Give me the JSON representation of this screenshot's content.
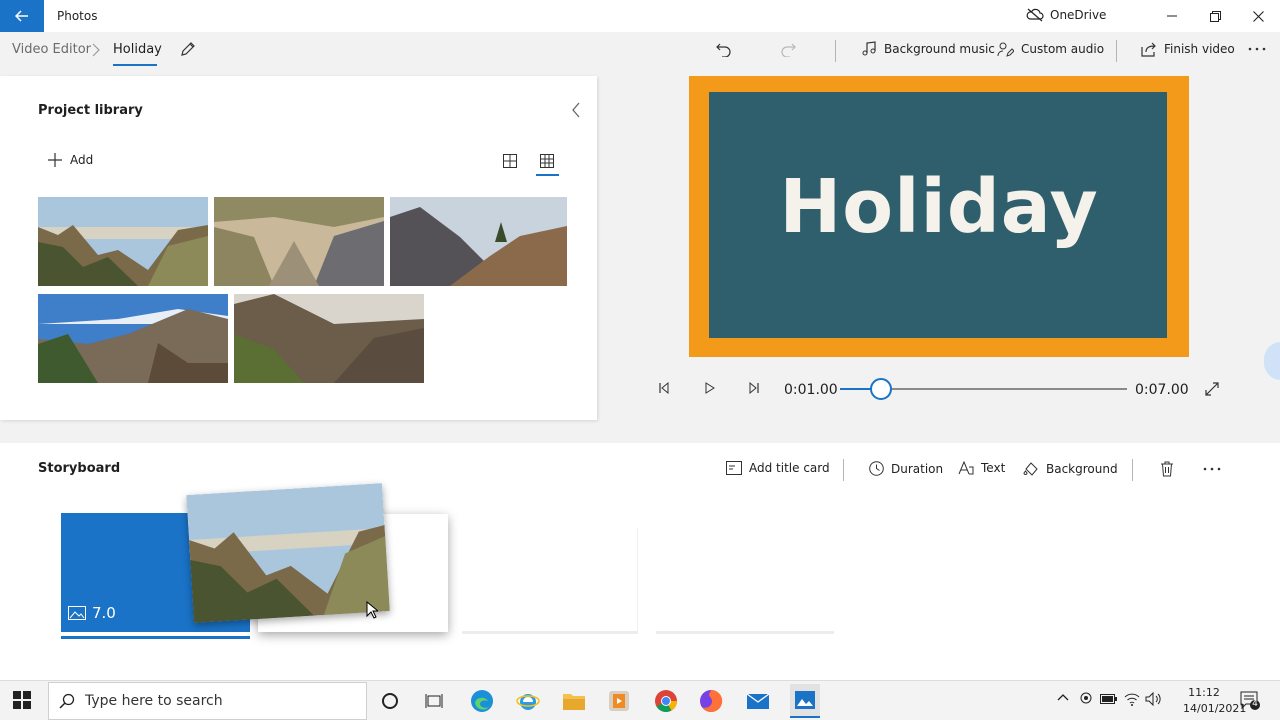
{
  "window": {
    "app_title": "Photos",
    "onedrive_label": "OneDrive"
  },
  "breadcrumb": {
    "root": "Video Editor",
    "current": "Holiday"
  },
  "toolbar": {
    "background_music": "Background music",
    "custom_audio": "Custom audio",
    "finish_video": "Finish video"
  },
  "library": {
    "title": "Project library",
    "add_label": "Add"
  },
  "preview": {
    "title_card_text": "Holiday",
    "current_time": "0:01.00",
    "total_time": "0:07.00",
    "progress": 0.143
  },
  "storyboard": {
    "title": "Storyboard",
    "add_title_card": "Add title card",
    "duration": "Duration",
    "text": "Text",
    "background": "Background",
    "clip_duration": "7.0"
  },
  "taskbar": {
    "search_placeholder": "Type here to search",
    "time": "11:12",
    "date": "14/01/2021",
    "notification_count": "4"
  },
  "colors": {
    "accent": "#1a73c7",
    "title_card_border": "#f39a1b",
    "title_card_fill": "#2f5f6d"
  }
}
